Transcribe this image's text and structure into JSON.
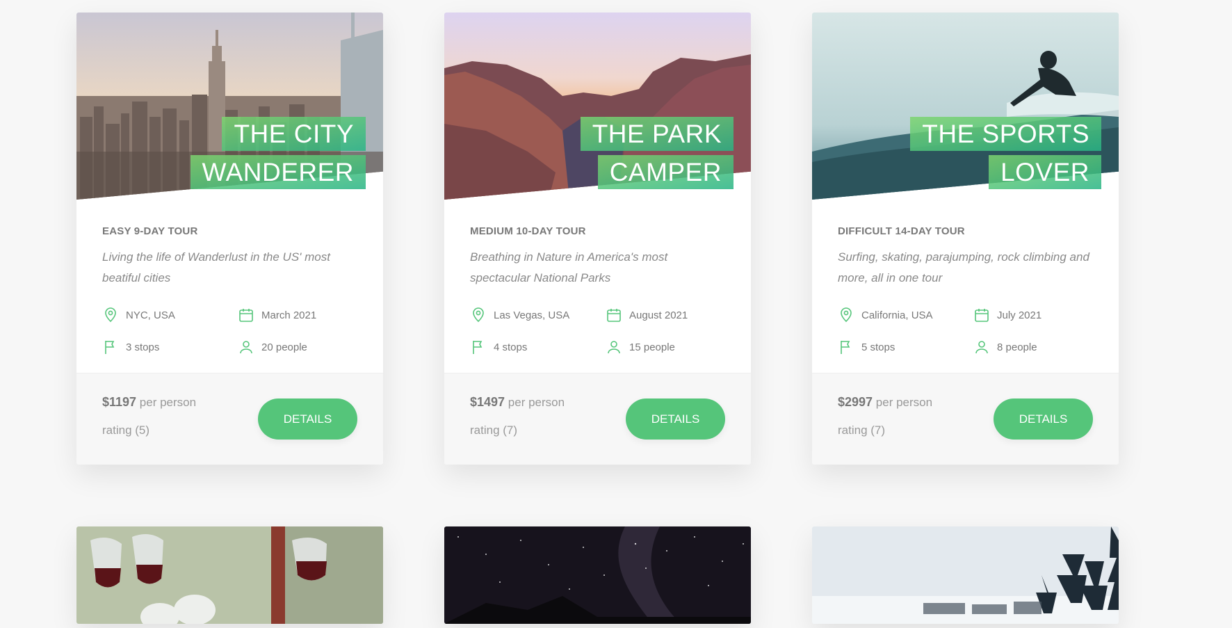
{
  "colors": {
    "accent": "#55c57a",
    "accent_dark": "#28b485",
    "background": "#f7f7f7"
  },
  "tours": [
    {
      "heading_line1": "The City",
      "heading_line2": "Wanderer",
      "subtitle": "Easy 9-day tour",
      "description": "Living the life of Wanderlust in the US' most beatiful cities",
      "location": "NYC, USA",
      "date": "March 2021",
      "stops": "3 stops",
      "group_size": "20 people",
      "price": "$1197",
      "price_suffix": "per person",
      "rating": "rating (5)",
      "button_label": "Details",
      "image_theme": "city skyline"
    },
    {
      "heading_line1": "The Park",
      "heading_line2": "Camper",
      "subtitle": "Medium 10-day tour",
      "description": "Breathing in Nature in America's most spectacular National Parks",
      "location": "Las Vegas, USA",
      "date": "August 2021",
      "stops": "4 stops",
      "group_size": "15 people",
      "price": "$1497",
      "price_suffix": "per person",
      "rating": "rating (7)",
      "button_label": "Details",
      "image_theme": "canyon at sunset"
    },
    {
      "heading_line1": "The Sports",
      "heading_line2": "Lover",
      "subtitle": "Difficult 14-day tour",
      "description": "Surfing, skating, parajumping, rock climbing and more, all in one tour",
      "location": "California, USA",
      "date": "July 2021",
      "stops": "5 stops",
      "group_size": "8 people",
      "price": "$2997",
      "price_suffix": "per person",
      "rating": "rating (7)",
      "button_label": "Details",
      "image_theme": "surfer on wave"
    }
  ],
  "icons": {
    "location": "map-pin-icon",
    "date": "calendar-icon",
    "stops": "flag-icon",
    "group": "user-icon"
  }
}
